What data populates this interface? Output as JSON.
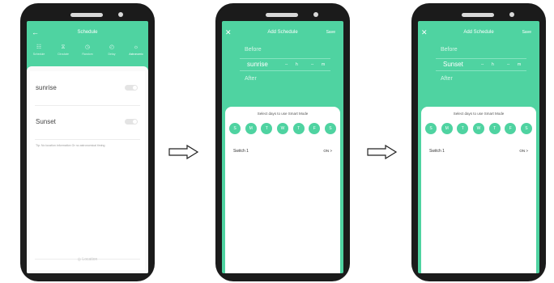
{
  "screen1": {
    "title": "Schedule",
    "tabs": [
      {
        "label": "Schedule",
        "icon": "calendar-icon",
        "glyph": "☷"
      },
      {
        "label": "Circulate",
        "icon": "hourglass-icon",
        "glyph": "⧖"
      },
      {
        "label": "Random",
        "icon": "timer-icon",
        "glyph": "◷"
      },
      {
        "label": "Delay",
        "icon": "clock-icon",
        "glyph": "◴"
      },
      {
        "label": "Astronomic",
        "icon": "sun-icon",
        "glyph": "☼"
      }
    ],
    "row1": "sunrise",
    "row2": "Sunset",
    "tip": "Tip: No location information Or no astronomical timing",
    "location": "Location"
  },
  "screen2": {
    "title": "Add Schedule",
    "save": "Save",
    "before": "Before",
    "event": "sunrise",
    "hours": "--",
    "h": "h",
    "minutes": "--",
    "m": "m",
    "after": "After",
    "select_days": "Select days to use Smart Mode",
    "days": [
      "S",
      "M",
      "T",
      "W",
      "T",
      "F",
      "S"
    ],
    "switch": "Switch 1",
    "switch_state": "ON >"
  },
  "screen3": {
    "title": "Add Schedule",
    "save": "Save",
    "before": "Before",
    "event": "Sunset",
    "hours": "--",
    "h": "h",
    "minutes": "--",
    "m": "m",
    "after": "After",
    "select_days": "Select days to use Smart Mode",
    "days": [
      "S",
      "M",
      "T",
      "W",
      "T",
      "F",
      "S"
    ],
    "switch": "Switch 1",
    "switch_state": "ON >"
  },
  "colors": {
    "accent": "#4fd3a1",
    "frame": "#1b1b1b"
  }
}
